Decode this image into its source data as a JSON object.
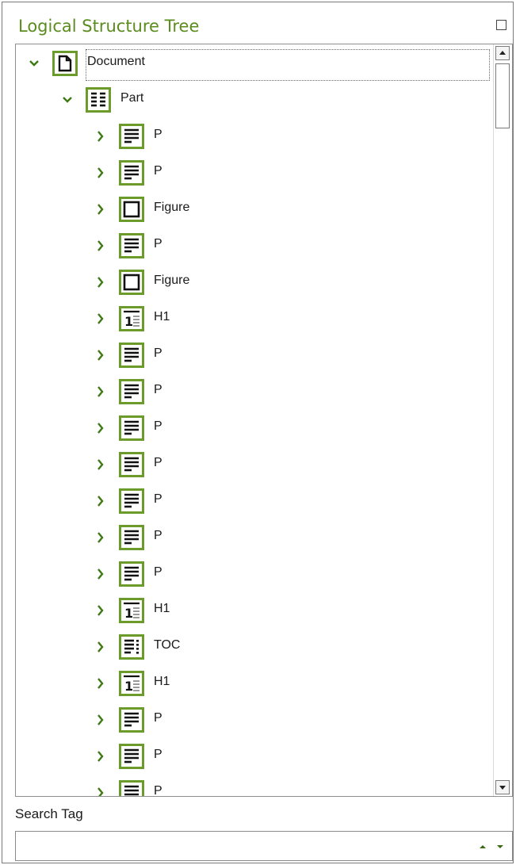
{
  "panel": {
    "title": "Logical Structure Tree"
  },
  "icons": {
    "maximize": "maximize-icon",
    "expanded": "chevron-down-icon",
    "collapsed": "chevron-right-icon"
  },
  "colors": {
    "accent": "#5b8c1e",
    "icon_border": "#6b9b2a"
  },
  "tree": {
    "rows": [
      {
        "label": "Document",
        "level": 0,
        "expanded": true,
        "icon": "document-icon",
        "selected": true
      },
      {
        "label": "Part",
        "level": 1,
        "expanded": true,
        "icon": "part-icon"
      },
      {
        "label": "P",
        "level": 2,
        "expanded": false,
        "icon": "paragraph-icon"
      },
      {
        "label": "P",
        "level": 2,
        "expanded": false,
        "icon": "paragraph-icon"
      },
      {
        "label": "Figure",
        "level": 2,
        "expanded": false,
        "icon": "figure-icon"
      },
      {
        "label": "P",
        "level": 2,
        "expanded": false,
        "icon": "paragraph-icon"
      },
      {
        "label": "Figure",
        "level": 2,
        "expanded": false,
        "icon": "figure-icon"
      },
      {
        "label": "H1",
        "level": 2,
        "expanded": false,
        "icon": "heading-icon"
      },
      {
        "label": "P",
        "level": 2,
        "expanded": false,
        "icon": "paragraph-icon"
      },
      {
        "label": "P",
        "level": 2,
        "expanded": false,
        "icon": "paragraph-icon"
      },
      {
        "label": "P",
        "level": 2,
        "expanded": false,
        "icon": "paragraph-icon"
      },
      {
        "label": "P",
        "level": 2,
        "expanded": false,
        "icon": "paragraph-icon"
      },
      {
        "label": "P",
        "level": 2,
        "expanded": false,
        "icon": "paragraph-icon"
      },
      {
        "label": "P",
        "level": 2,
        "expanded": false,
        "icon": "paragraph-icon"
      },
      {
        "label": "P",
        "level": 2,
        "expanded": false,
        "icon": "paragraph-icon"
      },
      {
        "label": "H1",
        "level": 2,
        "expanded": false,
        "icon": "heading-icon"
      },
      {
        "label": "TOC",
        "level": 2,
        "expanded": false,
        "icon": "toc-icon"
      },
      {
        "label": "H1",
        "level": 2,
        "expanded": false,
        "icon": "heading-icon"
      },
      {
        "label": "P",
        "level": 2,
        "expanded": false,
        "icon": "paragraph-icon"
      },
      {
        "label": "P",
        "level": 2,
        "expanded": false,
        "icon": "paragraph-icon"
      },
      {
        "label": "P",
        "level": 2,
        "expanded": false,
        "icon": "paragraph-icon"
      }
    ]
  },
  "search": {
    "label": "Search Tag",
    "value": ""
  }
}
